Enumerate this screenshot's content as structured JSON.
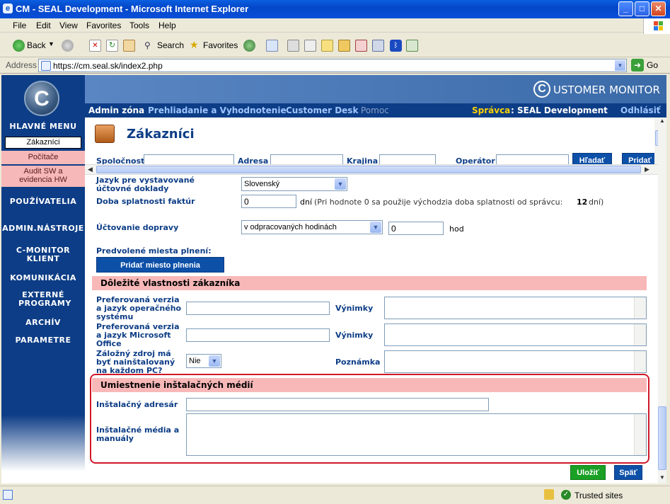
{
  "window": {
    "title": "CM - SEAL Development - Microsoft Internet Explorer"
  },
  "menu": [
    "File",
    "Edit",
    "View",
    "Favorites",
    "Tools",
    "Help"
  ],
  "toolbar": {
    "back": "Back",
    "search": "Search",
    "favorites": "Favorites"
  },
  "address": {
    "label": "Address",
    "url": "https://cm.seal.sk/index2.php",
    "go": "Go"
  },
  "brand": {
    "logo_letter": "C",
    "name": "USTOMER MONITOR"
  },
  "nav": {
    "admin": "Admin zóna",
    "review": "Prehliadanie a Vyhodnotenie",
    "desk": "Customer Desk",
    "help": "Pomoc",
    "admin_label": "Správca",
    "admin_value": ": SEAL Development",
    "logout": "Odhlásiť"
  },
  "sidebar": {
    "main_menu": "HLAVNÉ MENU",
    "customers": "Zákazníci",
    "computers": "Počítače",
    "audit": "Audit SW a evidencia HW",
    "users": "POUŽÍVATELIA",
    "admin_tools": "ADMIN.NÁSTROJE",
    "cmonitor_client": "C-MONITOR KLIENT",
    "communication": "KOMUNIKÁCIA",
    "external": "EXTERNÉ PROGRAMY",
    "archive": "ARCHÍV",
    "params": "PARAMETRE"
  },
  "page": {
    "title": "Zákazníci"
  },
  "filter": {
    "company": "Spoločnosť",
    "address": "Adresa",
    "country": "Krajina",
    "operator": "Operátor",
    "search_btn": "Hľadať",
    "add_btn": "Pridať"
  },
  "form": {
    "lang_invoice_label": "Jazyk pre vystavované účtovné doklady",
    "lang_invoice_value": "Slovenský",
    "due_label": "Doba splatnosti faktúr",
    "due_value": "0",
    "due_unit": "dní",
    "due_note": "(Pri hodnote 0 sa použije východzia doba splatnosti od správcu:",
    "due_default": "12",
    "due_note_end": "dní)",
    "transport_label": "Účtovanie dopravy",
    "transport_value": "v odpracovaných hodinách",
    "transport_hours": "0",
    "transport_unit": "hod",
    "places_label": "Predvolené miesta plnení:",
    "add_place_btn": "Pridať miesto plnenia"
  },
  "section_props": {
    "title": "Dôležité vlastnosti zákazníka",
    "os_label": "Preferovaná verzia a jazyk operačného systému",
    "office_label": "Preferovaná verzia a jazyk Microsoft Office",
    "exceptions": "Výnimky",
    "ups_label": "Záložný zdroj má byť nainštalovaný na každom PC?",
    "ups_value": "Nie",
    "note_label": "Poznámka"
  },
  "section_media": {
    "title": "Umiestnenie inštalačných médií",
    "dir_label": "Inštalačný adresár",
    "media_label": "Inštalačné média a manuály"
  },
  "actions": {
    "save": "Uložiť",
    "back": "Späť"
  },
  "status": {
    "zone": "Trusted sites"
  }
}
